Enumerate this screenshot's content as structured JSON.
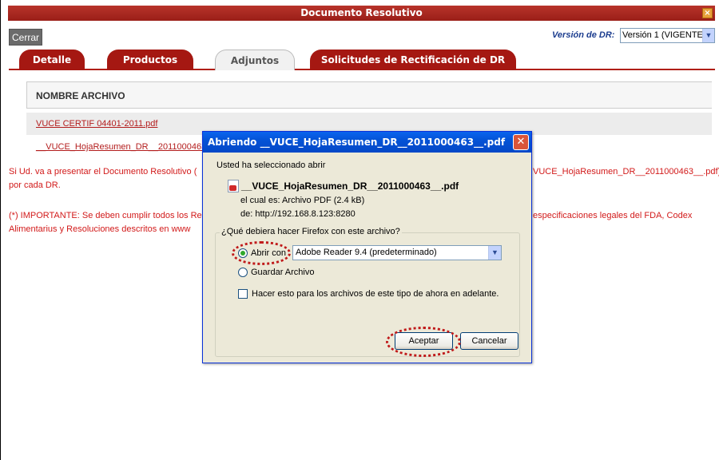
{
  "window": {
    "title": "Documento Resolutivo",
    "close_glyph": "×"
  },
  "toolbar": {
    "close_label": "Cerrar",
    "version_label": "Versión de DR:",
    "version_value": "Versión 1 (VIGENTE)"
  },
  "tabs": [
    {
      "label": "Detalle",
      "active": false
    },
    {
      "label": "Productos",
      "active": false
    },
    {
      "label": "Adjuntos",
      "active": true
    },
    {
      "label": "Solicitudes de Rectificación de DR",
      "active": false
    }
  ],
  "files": {
    "column_header": "NOMBRE ARCHIVO",
    "items": [
      "VUCE CERTIF 04401-2011.pdf",
      "__VUCE_HojaResumen_DR__2011000463"
    ]
  },
  "notices": {
    "line1_left": "Si Ud. va a presentar el Documento Resolutivo (",
    "line1_right": "VUCE_HojaResumen_DR__2011000463__.pdf)",
    "line2": "por cada DR.",
    "line3_left": "(*) IMPORTANTE: Se deben cumplir todos los Re",
    "line3_right": "especificaciones legales del FDA, Codex",
    "line4_left": "Alimentarius y Resoluciones descritos en www"
  },
  "dialog": {
    "title": "Abriendo __VUCE_HojaResumen_DR__2011000463__.pdf",
    "close_glyph": "✕",
    "intro": "Usted ha seleccionado abrir",
    "filename": "__VUCE_HojaResumen_DR__2011000463__.pdf",
    "type_line": "el cual es:  Archivo PDF (2.4 kB)",
    "from_line": "de:  http://192.168.8.123:8280",
    "question": "¿Qué debiera hacer Firefox con este archivo?",
    "open_with_label": "Abrir con",
    "open_with_app": "Adobe Reader 9.4 (predeterminado)",
    "save_label": "Guardar Archivo",
    "remember_label": "Hacer esto para los archivos de este tipo de ahora en adelante.",
    "ok_label": "Aceptar",
    "cancel_label": "Cancelar",
    "selected_option": "open"
  },
  "colors": {
    "title_bar": "#a82219",
    "tab": "#a51812",
    "link": "#b31d1d",
    "notice": "#d21a1a",
    "highlight": "#c01a1a",
    "dialog_titlebar": "#0453d6"
  }
}
